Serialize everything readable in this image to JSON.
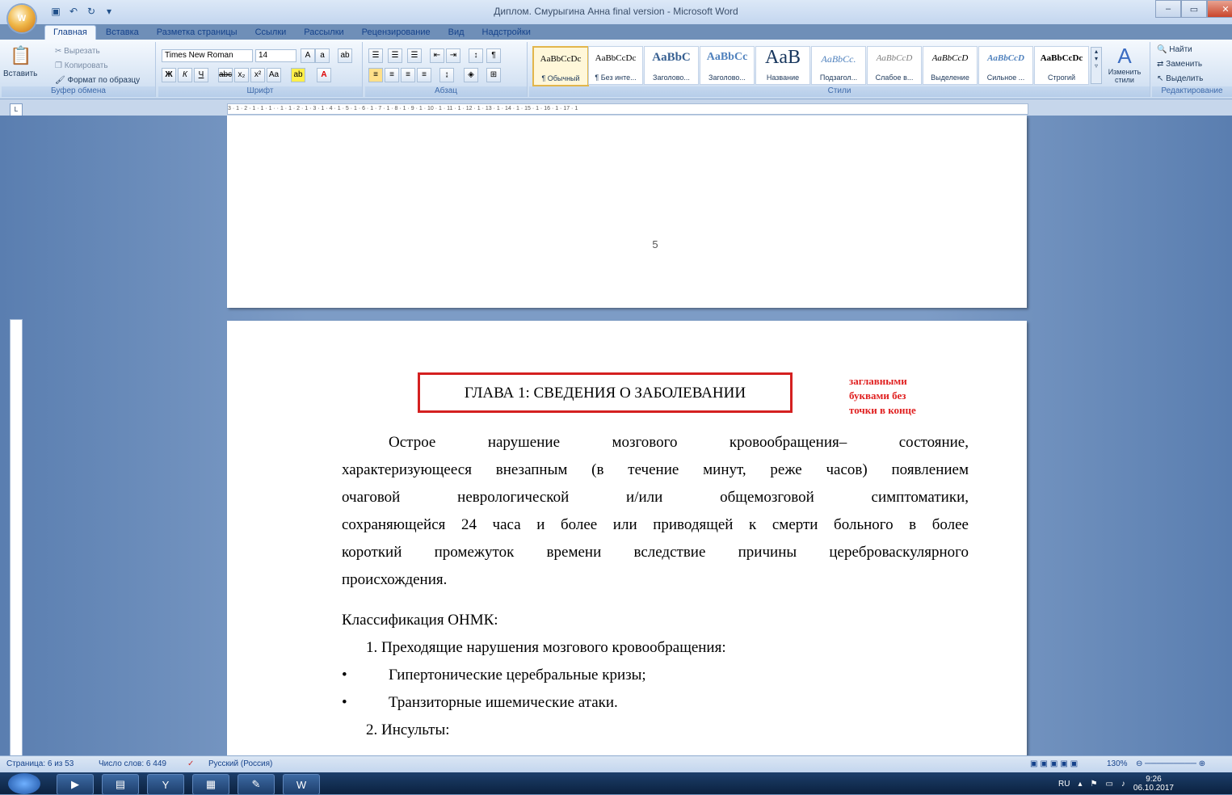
{
  "window": {
    "title": "Диплом. Смурыгина Анна final version  -  Microsoft Word",
    "orb_label": "W"
  },
  "tabs": [
    "Главная",
    "Вставка",
    "Разметка страницы",
    "Ссылки",
    "Рассылки",
    "Рецензирование",
    "Вид",
    "Надстройки"
  ],
  "clipboard": {
    "paste": "Вставить",
    "cut": "Вырезать",
    "copy": "Копировать",
    "format_painter": "Формат по образцу",
    "label": "Буфер обмена"
  },
  "font": {
    "name": "Times New Roman",
    "size": "14",
    "label": "Шрифт"
  },
  "paragraph": {
    "label": "Абзац"
  },
  "styles": {
    "label": "Стили",
    "items": [
      {
        "sample": "AaBbCcDc",
        "name": "¶ Обычный"
      },
      {
        "sample": "AaBbCcDc",
        "name": "¶ Без инте..."
      },
      {
        "sample": "AaBbC",
        "name": "Заголово..."
      },
      {
        "sample": "AaBbCc",
        "name": "Заголово..."
      },
      {
        "sample": "AaB",
        "name": "Название"
      },
      {
        "sample": "AaBbCc.",
        "name": "Подзагол..."
      },
      {
        "sample": "AaBbCcD",
        "name": "Слабое в..."
      },
      {
        "sample": "AaBbCcD",
        "name": "Выделение"
      },
      {
        "sample": "AaBbCcD",
        "name": "Сильное ..."
      },
      {
        "sample": "AaBbCcDc",
        "name": "Строгий"
      }
    ],
    "change": "Изменить стили"
  },
  "editing": {
    "find": "Найти",
    "replace": "Заменить",
    "select": "Выделить",
    "label": "Редактирование"
  },
  "ruler": "3 · 1 · 2 · 1 · 1 · 1 ·   · 1 · 1 · 2 · 1 · 3 · 1 · 4 · 1 · 5 · 1 · 6 · 1 · 7 · 1 · 8 · 1 · 9 · 1 · 10 · 1 · 11 · 1 · 12 · 1 · 13 · 1 · 14 · 1 · 15 · 1 · 16 · 1 · 17 · 1",
  "page1": {
    "number": "5"
  },
  "page2": {
    "heading": "ГЛАВА 1: СВЕДЕНИЯ О ЗАБОЛЕВАНИИ",
    "note": [
      "заглавными",
      "буквами без",
      "точки в конце"
    ],
    "para_lines": [
      "Острое нарушение мозгового кровообращения– состояние,",
      "характеризующееся внезапным (в течение минут, реже часов) появлением",
      "очаговой неврологической и/или общемозговой симптоматики,",
      "сохраняющейся 24 часа и более или приводящей к смерти больного в более",
      "короткий промежуток времени вследствие причины цереброваскулярного",
      "происхождения."
    ],
    "classification": "Классификация ОНМК:",
    "item1": "1.  Преходящие нарушения мозгового кровообращения:",
    "bullet1": "Гипертонические церебральные кризы;",
    "bullet2": "Транзиторные ишемические атаки.",
    "item2": "2.  Инсульты:"
  },
  "status": {
    "page": "Страница: 6 из 53",
    "words": "Число слов: 6 449",
    "lang": "Русский (Россия)",
    "zoom": "130%"
  },
  "tray": {
    "lang": "RU",
    "time": "9:26",
    "date": "06.10.2017"
  }
}
